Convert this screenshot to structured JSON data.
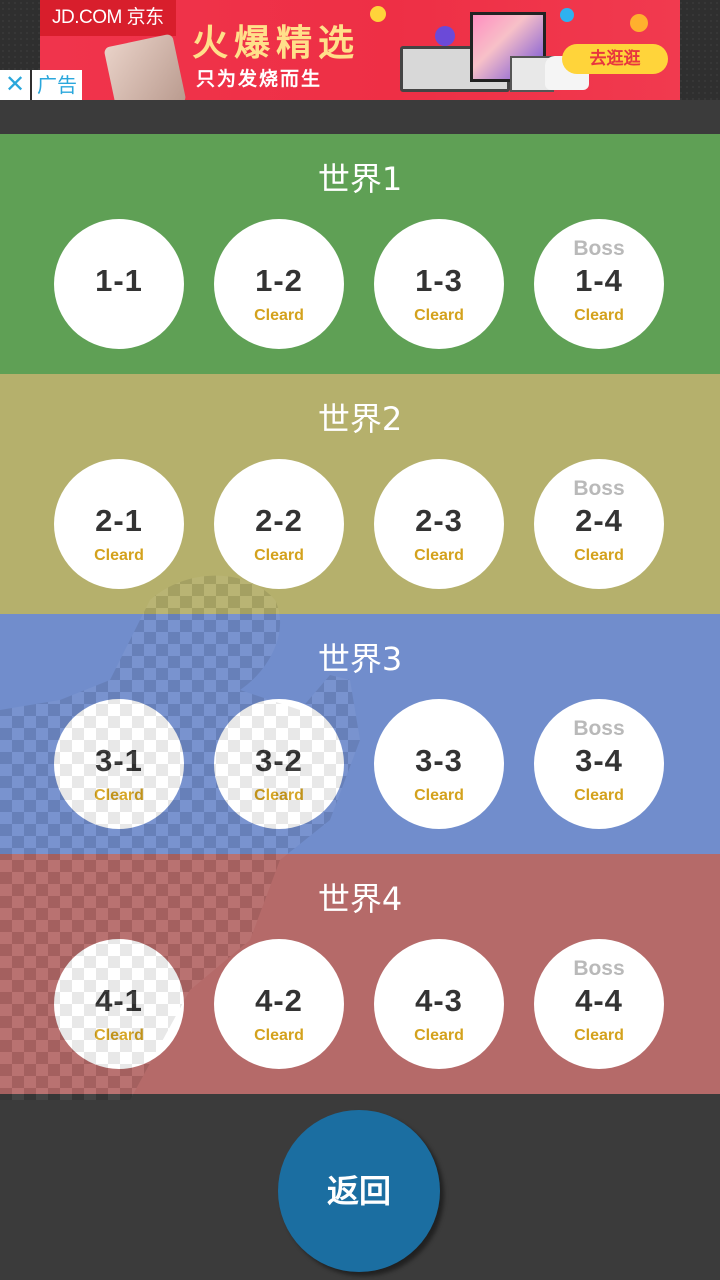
{
  "ad": {
    "brand": "JD.COM 京东",
    "headline": "火爆精选",
    "subline": "只为发烧而生",
    "cta": "去逛逛",
    "close": "✕",
    "label": "广告"
  },
  "worlds": [
    {
      "title": "世界1",
      "color": "#5fa055",
      "levels": [
        {
          "boss": "",
          "num": "1-1",
          "status": ""
        },
        {
          "boss": "",
          "num": "1-2",
          "status": "Cleard"
        },
        {
          "boss": "",
          "num": "1-3",
          "status": "Cleard"
        },
        {
          "boss": "Boss",
          "num": "1-4",
          "status": "Cleard"
        }
      ]
    },
    {
      "title": "世界2",
      "color": "#b5b06c",
      "levels": [
        {
          "boss": "",
          "num": "2-1",
          "status": "Cleard"
        },
        {
          "boss": "",
          "num": "2-2",
          "status": "Cleard"
        },
        {
          "boss": "",
          "num": "2-3",
          "status": "Cleard"
        },
        {
          "boss": "Boss",
          "num": "2-4",
          "status": "Cleard"
        }
      ]
    },
    {
      "title": "世界3",
      "color": "#718dcc",
      "levels": [
        {
          "boss": "",
          "num": "3-1",
          "status": "Cleard"
        },
        {
          "boss": "",
          "num": "3-2",
          "status": "Cleard"
        },
        {
          "boss": "",
          "num": "3-3",
          "status": "Cleard"
        },
        {
          "boss": "Boss",
          "num": "3-4",
          "status": "Cleard"
        }
      ]
    },
    {
      "title": "世界4",
      "color": "#b56a69",
      "levels": [
        {
          "boss": "",
          "num": "4-1",
          "status": "Cleard"
        },
        {
          "boss": "",
          "num": "4-2",
          "status": "Cleard"
        },
        {
          "boss": "",
          "num": "4-3",
          "status": "Cleard"
        },
        {
          "boss": "Boss",
          "num": "4-4",
          "status": "Cleard"
        }
      ]
    }
  ],
  "back_label": "返回"
}
